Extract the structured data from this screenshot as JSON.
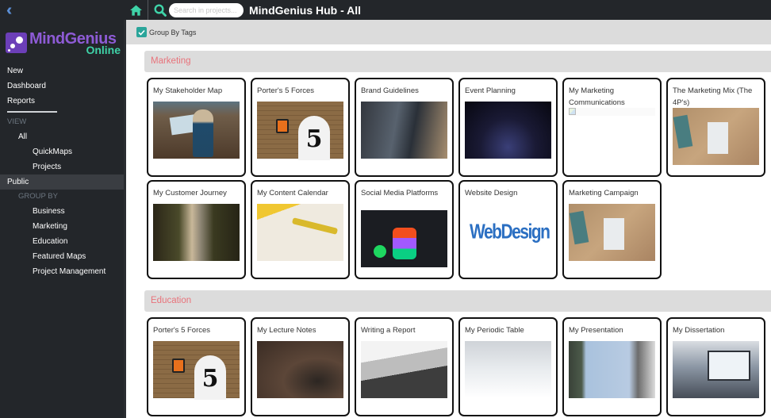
{
  "sidebar": {
    "collapse_icon": "double-chevron-left-icon",
    "logo": {
      "name": "MindGenius",
      "sub": "Online"
    },
    "primary": [
      "New",
      "Dashboard",
      "Reports"
    ],
    "view_label": "VIEW",
    "view_all": "All",
    "view_children": [
      "QuickMaps",
      "Projects"
    ],
    "public": "Public",
    "group_by_label": "GROUP BY",
    "groups": [
      "Business",
      "Marketing",
      "Education",
      "Featured Maps",
      "Project Management"
    ],
    "active_item": "Public"
  },
  "topbar": {
    "home_icon": "home-icon",
    "search_icon": "search-icon",
    "search_placeholder": "Search in projects...",
    "search_value": "",
    "title": "MindGenius Hub - All"
  },
  "toolbar": {
    "group_by_tags_label": "Group By Tags",
    "group_by_tags_checked": true
  },
  "groups": [
    {
      "name": "Marketing",
      "cards": [
        {
          "title": "My Stakeholder Map",
          "thumb": "stake"
        },
        {
          "title": "Porter's 5 Forces",
          "thumb": "porter"
        },
        {
          "title": "Brand Guidelines",
          "thumb": "brand"
        },
        {
          "title": "Event Planning",
          "thumb": "event"
        },
        {
          "title": "My Marketing Communications",
          "thumb": "broken"
        },
        {
          "title": "The Marketing Mix (The 4P's)",
          "thumb": "mix"
        },
        {
          "title": "My Customer Journey",
          "thumb": "journey"
        },
        {
          "title": "My Content Calendar",
          "thumb": "calendar"
        },
        {
          "title": "Social Media Platforms",
          "thumb": "social"
        },
        {
          "title": "Website Design",
          "thumb": "web"
        },
        {
          "title": "Marketing Campaign",
          "thumb": "mix"
        }
      ]
    },
    {
      "name": "Education",
      "cards": [
        {
          "title": "Porter's 5 Forces",
          "thumb": "porter"
        },
        {
          "title": "My Lecture Notes",
          "thumb": "lecture"
        },
        {
          "title": "Writing a Report",
          "thumb": "report"
        },
        {
          "title": "My Periodic Table",
          "thumb": "periodic"
        },
        {
          "title": "My Presentation",
          "thumb": "present"
        },
        {
          "title": "My Dissertation",
          "thumb": "dissert"
        }
      ]
    }
  ],
  "colors": {
    "accent": "#3fd3a8",
    "brand_purple": "#8e5bd6",
    "group_header_text": "#e8737b",
    "dark_bg": "#23262a"
  }
}
